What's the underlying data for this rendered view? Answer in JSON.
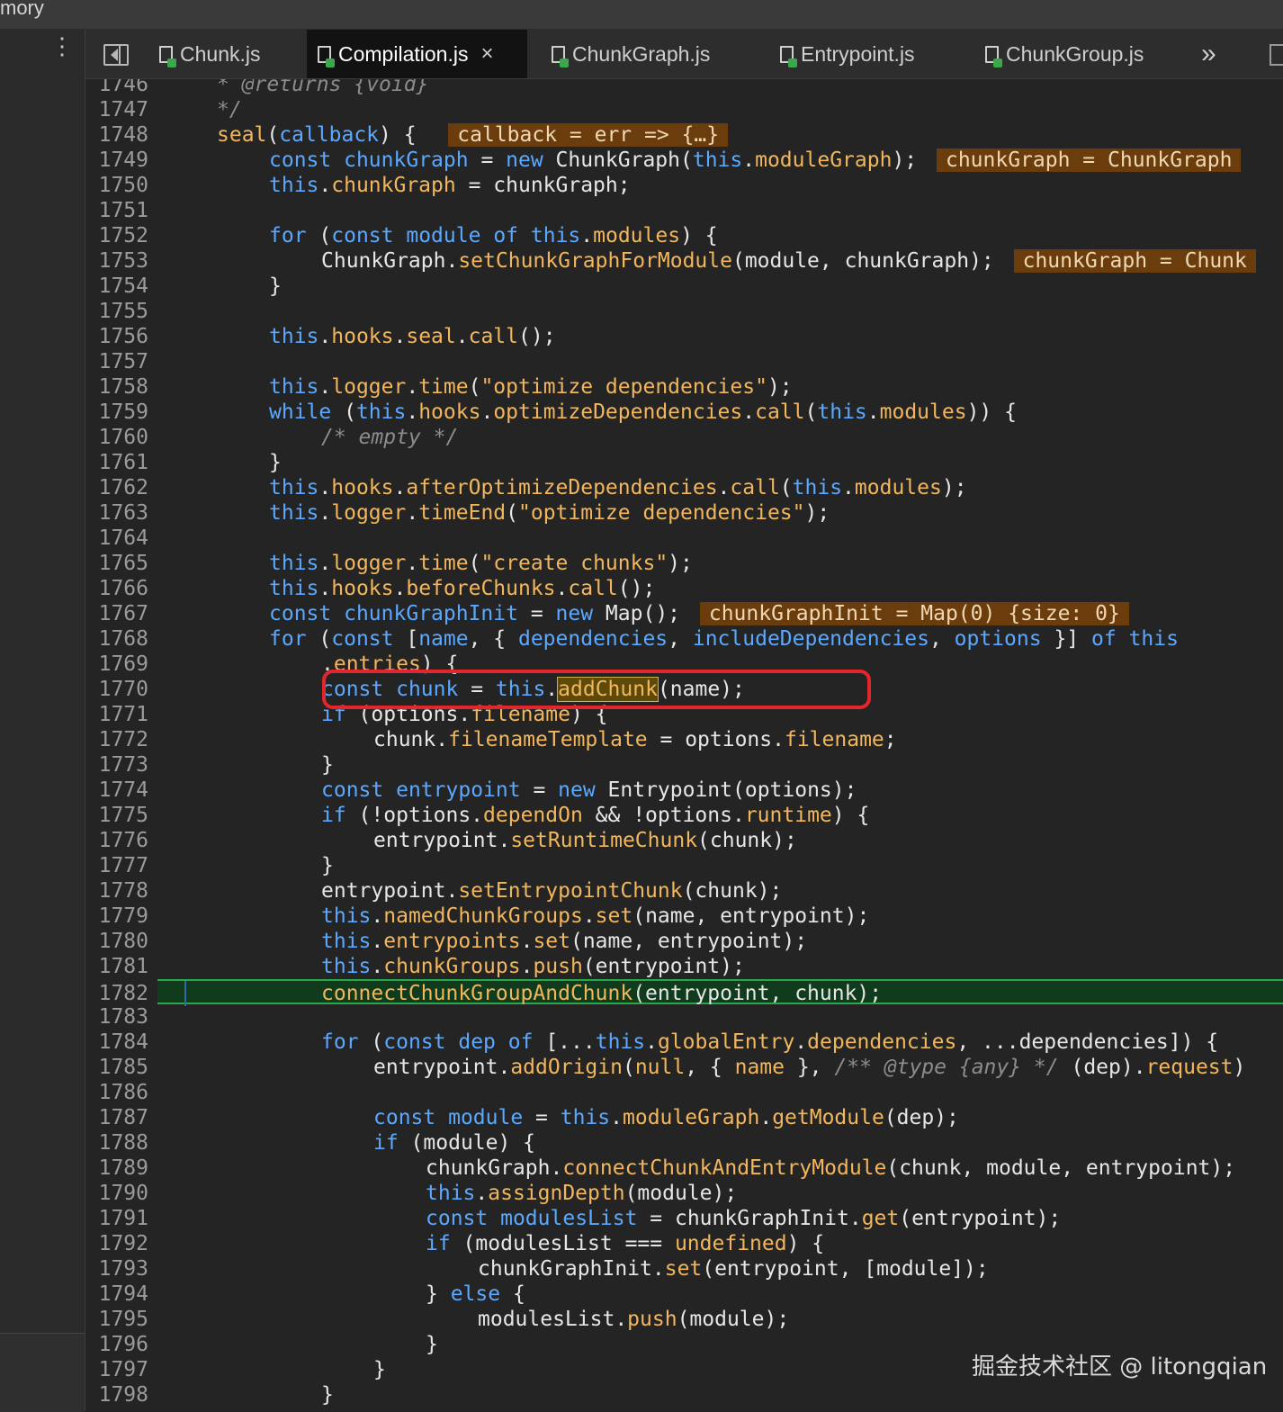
{
  "window": {
    "title": "mory"
  },
  "tabs": [
    {
      "label": "Chunk.js",
      "active": false
    },
    {
      "label": "Compilation.js",
      "active": true,
      "close_glyph": "×"
    },
    {
      "label": "ChunkGraph.js",
      "active": false
    },
    {
      "label": "Entrypoint.js",
      "active": false
    },
    {
      "label": "ChunkGroup.js",
      "active": false
    }
  ],
  "toolbar": {
    "overflow_glyph": "»"
  },
  "editor": {
    "line_start": 1746,
    "current_line": 1782,
    "lines": [
      {
        "n": "1746",
        "indent": 1,
        "html": "<span class='cm'>* @returns {void}</span>"
      },
      {
        "n": "1747",
        "indent": 1,
        "html": "<span class='cm'>*/</span>"
      },
      {
        "n": "1748",
        "indent": 1,
        "html": "<span class='fn'>seal</span>(<span class='kw'>callback</span>) {  <span class='hl'>callback = err =&gt; {…}</span>"
      },
      {
        "n": "1749",
        "indent": 2,
        "html": "<span class='kw'>const</span> <span class='kw'>chunkGraph</span> = <span class='kw'>new</span> ChunkGraph(<span class='kw'>this</span>.<span class='fn'>moduleGraph</span>); <span class='hl'>chunkGraph = ChunkGraph</span>"
      },
      {
        "n": "1750",
        "indent": 2,
        "html": "<span class='kw'>this</span>.<span class='fn'>chunkGraph</span> = chunkGraph;"
      },
      {
        "n": "1751",
        "indent": 0,
        "html": ""
      },
      {
        "n": "1752",
        "indent": 2,
        "html": "<span class='kw'>for</span> (<span class='kw'>const</span> <span class='kw'>module</span> <span class='kw'>of</span> <span class='kw'>this</span>.<span class='fn'>modules</span>) {"
      },
      {
        "n": "1753",
        "indent": 3,
        "html": "ChunkGraph.<span class='fn'>setChunkGraphForModule</span>(module, chunkGraph); <span class='hl'>chunkGraph = Chunk</span>"
      },
      {
        "n": "1754",
        "indent": 2,
        "html": "}"
      },
      {
        "n": "1755",
        "indent": 0,
        "html": ""
      },
      {
        "n": "1756",
        "indent": 2,
        "html": "<span class='kw'>this</span>.<span class='fn'>hooks</span>.<span class='fn'>seal</span>.<span class='fn'>call</span>();"
      },
      {
        "n": "1757",
        "indent": 0,
        "html": ""
      },
      {
        "n": "1758",
        "indent": 2,
        "html": "<span class='kw'>this</span>.<span class='fn'>logger</span>.<span class='fn'>time</span>(<span class='str'>\"optimize dependencies\"</span>);"
      },
      {
        "n": "1759",
        "indent": 2,
        "html": "<span class='kw'>while</span> (<span class='kw'>this</span>.<span class='fn'>hooks</span>.<span class='fn'>optimizeDependencies</span>.<span class='fn'>call</span>(<span class='kw'>this</span>.<span class='fn'>modules</span>)) {"
      },
      {
        "n": "1760",
        "indent": 3,
        "html": "<span class='cm'>/* empty */</span>"
      },
      {
        "n": "1761",
        "indent": 2,
        "html": "}"
      },
      {
        "n": "1762",
        "indent": 2,
        "html": "<span class='kw'>this</span>.<span class='fn'>hooks</span>.<span class='fn'>afterOptimizeDependencies</span>.<span class='fn'>call</span>(<span class='kw'>this</span>.<span class='fn'>modules</span>);"
      },
      {
        "n": "1763",
        "indent": 2,
        "html": "<span class='kw'>this</span>.<span class='fn'>logger</span>.<span class='fn'>timeEnd</span>(<span class='str'>\"optimize dependencies\"</span>);"
      },
      {
        "n": "1764",
        "indent": 0,
        "html": ""
      },
      {
        "n": "1765",
        "indent": 2,
        "html": "<span class='kw'>this</span>.<span class='fn'>logger</span>.<span class='fn'>time</span>(<span class='str'>\"create chunks\"</span>);"
      },
      {
        "n": "1766",
        "indent": 2,
        "html": "<span class='kw'>this</span>.<span class='fn'>hooks</span>.<span class='fn'>beforeChunks</span>.<span class='fn'>call</span>();"
      },
      {
        "n": "1767",
        "indent": 2,
        "html": "<span class='kw'>const</span> <span class='kw'>chunkGraphInit</span> = <span class='kw'>new</span> Map(); <span class='hl'>chunkGraphInit = Map(0) {size: 0}</span>"
      },
      {
        "n": "1768",
        "indent": 2,
        "html": "<span class='kw'>for</span> (<span class='kw'>const</span> [<span class='kw'>name</span>, { <span class='kw'>dependencies</span>, <span class='kw'>includeDependencies</span>, <span class='kw'>options</span> }] <span class='kw'>of</span> <span class='kw'>this</span>"
      },
      {
        "n": "1769",
        "indent": 3,
        "html": ".<span class='fn'>entries</span>) {"
      },
      {
        "n": "1770",
        "indent": 3,
        "html": "<span class='kw'>const</span> <span class='kw'>chunk</span> = <span class='kw'>this</span>.<span class='fn gold-hl'>addChunk</span>(name);"
      },
      {
        "n": "1771",
        "indent": 3,
        "html": "<span class='kw'>if</span> (options.<span class='fn'>filename</span>) {"
      },
      {
        "n": "1772",
        "indent": 4,
        "html": "chunk.<span class='fn'>filenameTemplate</span> = options.<span class='fn'>filename</span>;"
      },
      {
        "n": "1773",
        "indent": 3,
        "html": "}"
      },
      {
        "n": "1774",
        "indent": 3,
        "html": "<span class='kw'>const</span> <span class='kw'>entrypoint</span> = <span class='kw'>new</span> Entrypoint(options);"
      },
      {
        "n": "1775",
        "indent": 3,
        "html": "<span class='kw'>if</span> (!options.<span class='fn'>dependOn</span> &amp;&amp; !options.<span class='fn'>runtime</span>) {"
      },
      {
        "n": "1776",
        "indent": 4,
        "html": "entrypoint.<span class='fn'>setRuntimeChunk</span>(chunk);"
      },
      {
        "n": "1777",
        "indent": 3,
        "html": "}"
      },
      {
        "n": "1778",
        "indent": 3,
        "html": "entrypoint.<span class='fn'>setEntrypointChunk</span>(chunk);"
      },
      {
        "n": "1779",
        "indent": 3,
        "html": "<span class='kw'>this</span>.<span class='fn'>namedChunkGroups</span>.<span class='fn'>set</span>(name, entrypoint);"
      },
      {
        "n": "1780",
        "indent": 3,
        "html": "<span class='kw'>this</span>.<span class='fn'>entrypoints</span>.<span class='fn'>set</span>(name, entrypoint);"
      },
      {
        "n": "1781",
        "indent": 3,
        "html": "<span class='kw'>this</span>.<span class='fn'>chunkGroups</span>.<span class='fn'>push</span>(entrypoint);"
      },
      {
        "n": "1782",
        "indent": 3,
        "html": "<span class='fn'>connectChunkGroupAndChunk</span>(entrypoint, chunk);"
      },
      {
        "n": "1783",
        "indent": 0,
        "html": ""
      },
      {
        "n": "1784",
        "indent": 3,
        "html": "<span class='kw'>for</span> (<span class='kw'>const</span> <span class='kw'>dep</span> <span class='kw'>of</span> [...<span class='kw'>this</span>.<span class='fn'>globalEntry</span>.<span class='fn'>dependencies</span>, ...dependencies]) {"
      },
      {
        "n": "1785",
        "indent": 4,
        "html": "entrypoint.<span class='fn'>addOrigin</span>(<span class='fn'>null</span>, { <span class='fn'>name</span> }, <span class='cm'>/** @type {any} */</span> (dep).<span class='fn'>request</span>)"
      },
      {
        "n": "1786",
        "indent": 0,
        "html": ""
      },
      {
        "n": "1787",
        "indent": 4,
        "html": "<span class='kw'>const</span> <span class='kw'>module</span> = <span class='kw'>this</span>.<span class='fn'>moduleGraph</span>.<span class='fn'>getModule</span>(dep);"
      },
      {
        "n": "1788",
        "indent": 4,
        "html": "<span class='kw'>if</span> (module) {"
      },
      {
        "n": "1789",
        "indent": 5,
        "html": "chunkGraph.<span class='fn'>connectChunkAndEntryModule</span>(chunk, module, entrypoint);"
      },
      {
        "n": "1790",
        "indent": 5,
        "html": "<span class='kw'>this</span>.<span class='fn'>assignDepth</span>(module);"
      },
      {
        "n": "1791",
        "indent": 5,
        "html": "<span class='kw'>const</span> <span class='kw'>modulesList</span> = chunkGraphInit.<span class='fn'>get</span>(entrypoint);"
      },
      {
        "n": "1792",
        "indent": 5,
        "html": "<span class='kw'>if</span> (modulesList === <span class='fn'>undefined</span>) {"
      },
      {
        "n": "1793",
        "indent": 6,
        "html": "chunkGraphInit.<span class='fn'>set</span>(entrypoint, [module]);"
      },
      {
        "n": "1794",
        "indent": 5,
        "html": "} <span class='kw'>else</span> {"
      },
      {
        "n": "1795",
        "indent": 6,
        "html": "modulesList.<span class='fn'>push</span>(module);"
      },
      {
        "n": "1796",
        "indent": 5,
        "html": "}"
      },
      {
        "n": "1797",
        "indent": 4,
        "html": "}"
      },
      {
        "n": "1798",
        "indent": 3,
        "html": "}"
      }
    ]
  },
  "watermark": {
    "text": "掘金技术社区 @ litongqian"
  },
  "icons": [
    "kebab-menu-icon",
    "panel-toggle-icon",
    "file-icon",
    "close-icon",
    "chevrons-right-icon"
  ],
  "colors": {
    "keyword": "#5aa8ff",
    "function": "#f2b65c",
    "current_line": "#103c1d",
    "inline_value_bg": "#6b3d0c",
    "annotation_box": "#e3262d"
  }
}
